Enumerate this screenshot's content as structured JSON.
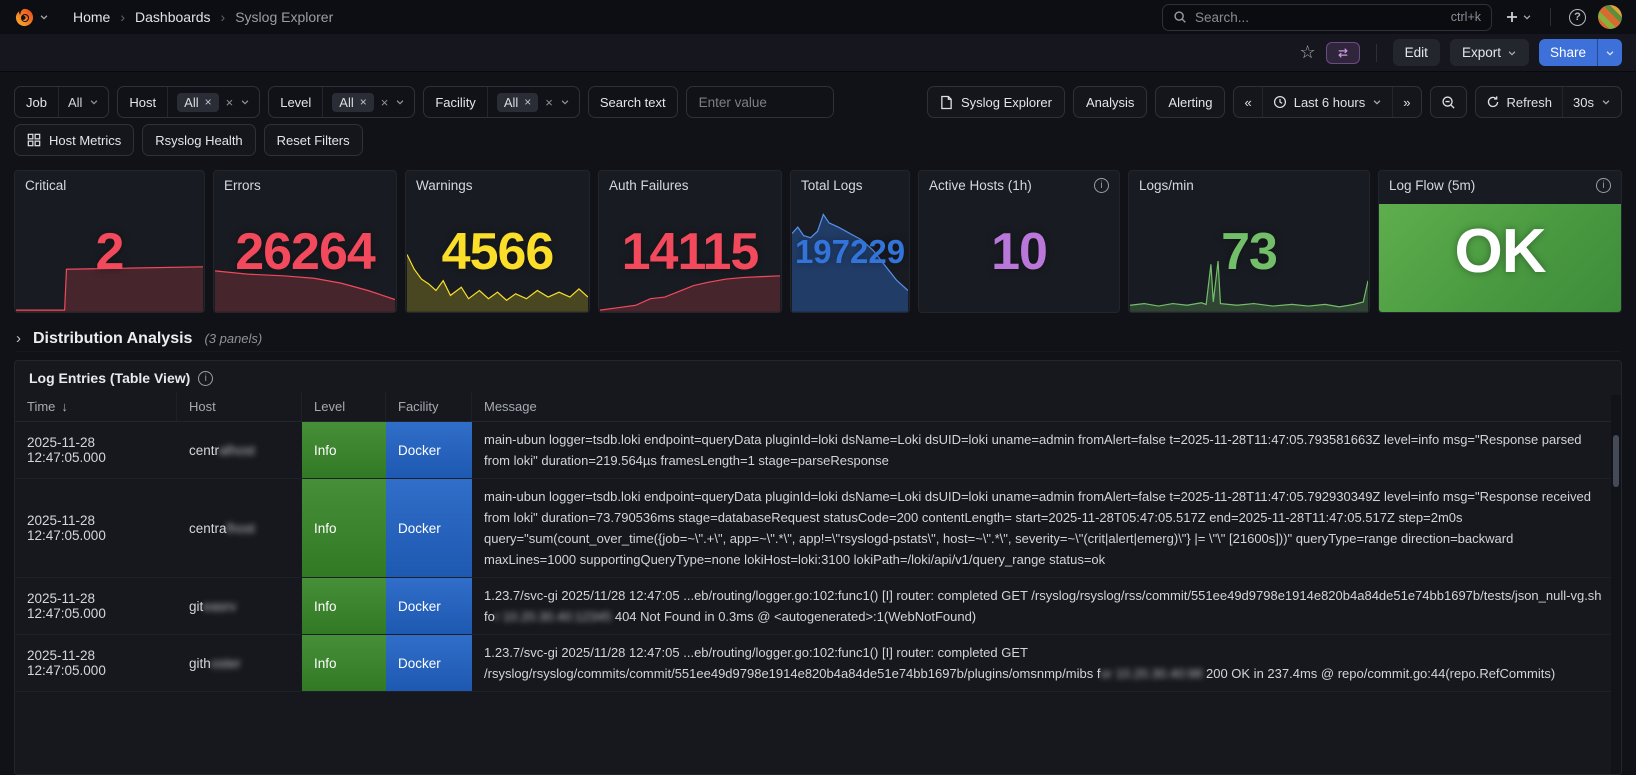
{
  "nav": {
    "breadcrumb": [
      "Home",
      "Dashboards",
      "Syslog Explorer"
    ],
    "search_placeholder": "Search...",
    "search_shortcut": "ctrl+k"
  },
  "toolbar": {
    "edit": "Edit",
    "export": "Export",
    "share": "Share"
  },
  "filters": {
    "job": {
      "label": "Job",
      "value": "All"
    },
    "host": {
      "label": "Host",
      "chip": "All"
    },
    "level": {
      "label": "Level",
      "chip": "All"
    },
    "facility": {
      "label": "Facility",
      "chip": "All"
    },
    "search_text": {
      "label": "Search text",
      "placeholder": "Enter value"
    }
  },
  "quick_links": {
    "syslog_explorer": "Syslog Explorer",
    "analysis": "Analysis",
    "alerting": "Alerting"
  },
  "time_controls": {
    "range": "Last 6 hours",
    "refresh_label": "Refresh",
    "interval": "30s"
  },
  "filter_actions": {
    "host_metrics": "Host Metrics",
    "rsyslog_health": "Rsyslog Health",
    "reset_filters": "Reset Filters"
  },
  "stats": [
    {
      "title": "Critical",
      "value": "2",
      "color": "#F2495C",
      "spark": {
        "type": "area",
        "color": "#F2495C",
        "fill": "rgba(242,73,92,0.22)",
        "points": [
          [
            0,
            0.02
          ],
          [
            0.26,
            0.02
          ],
          [
            0.27,
            0.52
          ],
          [
            1,
            0.55
          ]
        ]
      }
    },
    {
      "title": "Errors",
      "value": "26264",
      "color": "#F2495C",
      "spark": {
        "type": "area",
        "color": "#F2495C",
        "fill": "rgba(242,73,92,0.22)",
        "points": [
          [
            0,
            0.5
          ],
          [
            0.18,
            0.46
          ],
          [
            0.38,
            0.44
          ],
          [
            0.55,
            0.41
          ],
          [
            0.7,
            0.35
          ],
          [
            0.85,
            0.26
          ],
          [
            1,
            0.15
          ]
        ]
      }
    },
    {
      "title": "Warnings",
      "value": "4566",
      "color": "#FADE2A",
      "spark": {
        "type": "area",
        "color": "#FADE2A",
        "fill": "rgba(250,222,42,0.22)",
        "points": [
          [
            0,
            0.7
          ],
          [
            0.04,
            0.52
          ],
          [
            0.08,
            0.4
          ],
          [
            0.12,
            0.34
          ],
          [
            0.16,
            0.26
          ],
          [
            0.2,
            0.38
          ],
          [
            0.24,
            0.2
          ],
          [
            0.3,
            0.3
          ],
          [
            0.34,
            0.16
          ],
          [
            0.4,
            0.26
          ],
          [
            0.45,
            0.16
          ],
          [
            0.5,
            0.24
          ],
          [
            0.55,
            0.14
          ],
          [
            0.6,
            0.22
          ],
          [
            0.66,
            0.16
          ],
          [
            0.72,
            0.26
          ],
          [
            0.78,
            0.18
          ],
          [
            0.84,
            0.24
          ],
          [
            0.9,
            0.18
          ],
          [
            0.95,
            0.28
          ],
          [
            1,
            0.18
          ]
        ]
      }
    },
    {
      "title": "Auth Failures",
      "value": "14115",
      "color": "#F2495C",
      "spark": {
        "type": "area",
        "color": "#F2495C",
        "fill": "rgba(242,73,92,0.22)",
        "points": [
          [
            0,
            0.02
          ],
          [
            0.1,
            0.05
          ],
          [
            0.2,
            0.08
          ],
          [
            0.28,
            0.16
          ],
          [
            0.36,
            0.18
          ],
          [
            0.44,
            0.25
          ],
          [
            0.52,
            0.32
          ],
          [
            0.6,
            0.36
          ],
          [
            0.7,
            0.4
          ],
          [
            0.8,
            0.42
          ],
          [
            0.9,
            0.43
          ],
          [
            1,
            0.44
          ]
        ]
      }
    },
    {
      "title": "Total Logs",
      "value": "197229",
      "color": "#3274D9",
      "spark": {
        "type": "area",
        "color": "#5794F2",
        "fill": "rgba(50,116,217,0.38)",
        "points": [
          [
            0,
            0.74
          ],
          [
            0.05,
            0.8
          ],
          [
            0.1,
            0.72
          ],
          [
            0.16,
            0.7
          ],
          [
            0.22,
            0.76
          ],
          [
            0.27,
            0.92
          ],
          [
            0.32,
            0.84
          ],
          [
            0.4,
            0.8
          ],
          [
            0.5,
            0.74
          ],
          [
            0.6,
            0.68
          ],
          [
            0.7,
            0.58
          ],
          [
            0.8,
            0.44
          ],
          [
            0.9,
            0.3
          ],
          [
            1,
            0.2
          ]
        ]
      }
    },
    {
      "title": "Active Hosts (1h)",
      "value": "10",
      "color": "#B877D9",
      "info": true
    },
    {
      "title": "Logs/min",
      "value": "73",
      "color": "#73BF69",
      "spark": {
        "type": "area",
        "color": "#73BF69",
        "fill": "rgba(115,191,105,0.25)",
        "points": [
          [
            0,
            0.08
          ],
          [
            0.06,
            0.1
          ],
          [
            0.12,
            0.07
          ],
          [
            0.18,
            0.1
          ],
          [
            0.24,
            0.08
          ],
          [
            0.3,
            0.11
          ],
          [
            0.32,
            0.09
          ],
          [
            0.34,
            0.58
          ],
          [
            0.35,
            0.12
          ],
          [
            0.37,
            0.62
          ],
          [
            0.38,
            0.1
          ],
          [
            0.45,
            0.08
          ],
          [
            0.52,
            0.1
          ],
          [
            0.6,
            0.07
          ],
          [
            0.68,
            0.09
          ],
          [
            0.75,
            0.07
          ],
          [
            0.82,
            0.09
          ],
          [
            0.88,
            0.06
          ],
          [
            0.94,
            0.09
          ],
          [
            0.98,
            0.12
          ],
          [
            1,
            0.38
          ]
        ]
      }
    },
    {
      "title": "Log Flow (5m)",
      "value": "OK",
      "color": "#FFFFFF",
      "info": true,
      "flow_bg": true
    }
  ],
  "section": {
    "title": "Distribution Analysis",
    "meta": "(3 panels)"
  },
  "table": {
    "title": "Log Entries (Table View)",
    "columns": [
      "Time",
      "Host",
      "Level",
      "Facility",
      "Message"
    ],
    "level_color": "#388729",
    "facility_color": "#2163c5",
    "rows": [
      {
        "time": "2025-11-28 12:47:05.000",
        "host": {
          "prefix": "centr",
          "blur": "alhost"
        },
        "level": "Info",
        "facility": "Docker",
        "message": [
          {
            "t": "main-ubun logger=tsdb.loki endpoint=queryData pluginId=loki dsName=Loki dsUID=loki uname=admin fromAlert=false t=2025-11-28T11:47:05.793581663Z level=info msg=\"Response parsed from loki\" duration=219.564µs framesLength=1 stage=parseResponse"
          }
        ]
      },
      {
        "time": "2025-11-28 12:47:05.000",
        "host": {
          "prefix": "centra",
          "blur": "lhost"
        },
        "level": "Info",
        "facility": "Docker",
        "message": [
          {
            "t": "main-ubun logger=tsdb.loki endpoint=queryData pluginId=loki dsName=Loki dsUID=loki uname=admin fromAlert=false t=2025-11-28T11:47:05.792930349Z level=info msg=\"Response received from loki\" duration=73.790536ms stage=databaseRequest statusCode=200 contentLength= start=2025-11-28T05:47:05.517Z end=2025-11-28T11:47:05.517Z step=2m0s query=\"sum(count_over_time({job=~\\\".+\\\", app=~\\\".*\\\", app!=\\\"rsyslogd-pstats\\\", host=~\\\".*\\\", severity=~\\\"(crit|alert|emerg)\\\"} |= \\\"\\\" [21600s]))\" queryType=range direction=backward maxLines=1000 supportingQueryType=none lokiHost=loki:3100 lokiPath=/loki/api/v1/query_range status=ok"
          }
        ]
      },
      {
        "time": "2025-11-28 12:47:05.000",
        "host": {
          "prefix": "git",
          "blur": "easrv"
        },
        "level": "Info",
        "facility": "Docker",
        "message": [
          {
            "t": "1.23.7/svc-gi 2025/11/28 12:47:05 ...eb/routing/logger.go:102:func1() [I] router: completed GET /rsyslog/rsyslog/rss/commit/551ee49d9798e1914e820b4a84de51e74bb1697b/tests/json_null-vg.sh fo"
          },
          {
            "t": "r 10.20.30.40:12345 ",
            "blur": true
          },
          {
            "t": "404 Not Found in 0.3ms @ <autogenerated>:1(WebNotFound)"
          }
        ]
      },
      {
        "time": "2025-11-28 12:47:05.000",
        "host": {
          "prefix": "gith",
          "blur": "oster"
        },
        "level": "Info",
        "facility": "Docker",
        "message": [
          {
            "t": "1.23.7/svc-gi 2025/11/28 12:47:05 ...eb/routing/logger.go:102:func1() [I] router: completed GET /rsyslog/rsyslog/commits/commit/551ee49d9798e1914e820b4a84de51e74bb1697b/plugins/omsnmp/mibs f"
          },
          {
            "t": "or 10.20.30.40:98 ",
            "blur": true
          },
          {
            "t": " 200 OK in 237.4ms @ repo/commit.go:44(repo.RefCommits)"
          }
        ]
      }
    ]
  }
}
